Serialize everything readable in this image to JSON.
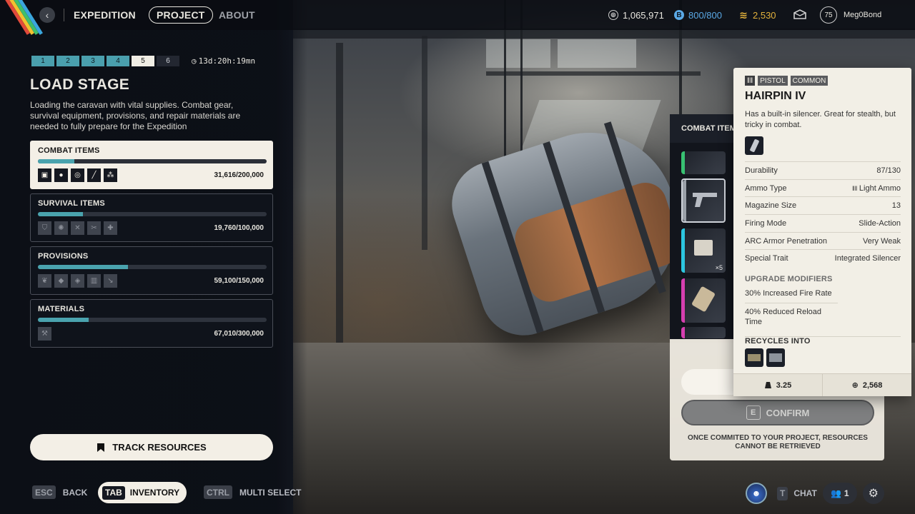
{
  "topbar": {
    "title": "EXPEDITION",
    "tabs": {
      "project": "PROJECT",
      "about": "ABOUT"
    },
    "currency_coins": "1,065,971",
    "currency_slots": "800/800",
    "currency_gold": "2,530",
    "player_level": "75",
    "username": "Meg0Bond"
  },
  "project": {
    "stages": [
      "1",
      "2",
      "3",
      "4",
      "5",
      "6"
    ],
    "timer": "13d:20h:19mn",
    "title": "LOAD STAGE",
    "description": "Loading the caravan with vital supplies. Combat gear, survival equipment, provisions, and repair materials are needed to fully prepare for the Expedition",
    "categories": [
      {
        "name": "COMBAT ITEMS",
        "amount": "31,616/200,000",
        "progress": 0.158
      },
      {
        "name": "SURVIVAL ITEMS",
        "amount": "19,760/100,000",
        "progress": 0.198
      },
      {
        "name": "PROVISIONS",
        "amount": "59,100/150,000",
        "progress": 0.394
      },
      {
        "name": "MATERIALS",
        "amount": "67,010/300,000",
        "progress": 0.223
      }
    ],
    "track_label": "TRACK RESOURCES"
  },
  "hints": {
    "esc_key": "ESC",
    "back": "BACK",
    "tab_key": "TAB",
    "inventory": "INVENTORY",
    "ctrl_key": "CTRL",
    "multi_select": "MULTI SELECT",
    "t_key": "T",
    "chat": "CHAT",
    "friends_count": "1"
  },
  "inventory": {
    "header": "COMBAT ITEMS",
    "stack_count": "×5",
    "confirm_key": "E",
    "confirm_label": "CONFIRM",
    "note": "ONCE COMMITED TO YOUR PROJECT, RESOURCES CANNOT BE RETRIEVED"
  },
  "tooltip": {
    "tags": [
      "PISTOL",
      "COMMON"
    ],
    "name": "HAIRPIN IV",
    "description": "Has a built-in silencer. Great for stealth, but tricky in combat.",
    "stats": [
      {
        "label": "Durability",
        "value": "87/130"
      },
      {
        "label": "Ammo Type",
        "value": "Light Ammo"
      },
      {
        "label": "Magazine Size",
        "value": "13"
      },
      {
        "label": "Firing Mode",
        "value": "Slide-Action"
      },
      {
        "label": "ARC Armor Penetration",
        "value": "Very Weak"
      },
      {
        "label": "Special Trait",
        "value": "Integrated Silencer"
      }
    ],
    "upgrade_header": "UPGRADE MODIFIERS",
    "modifiers": [
      "30% Increased Fire Rate",
      "40% Reduced Reload Time"
    ],
    "recycle_header": "RECYCLES INTO",
    "weight": "3.25",
    "value": "2,568"
  },
  "colors": {
    "accent_teal": "#4aa3ae",
    "cream": "#f3efe6",
    "gold": "#e3b23c",
    "blue": "#5aa9e6",
    "rarity_green": "#38c172",
    "rarity_magenta": "#d63fb0",
    "rarity_cyan": "#2cc6e0"
  }
}
